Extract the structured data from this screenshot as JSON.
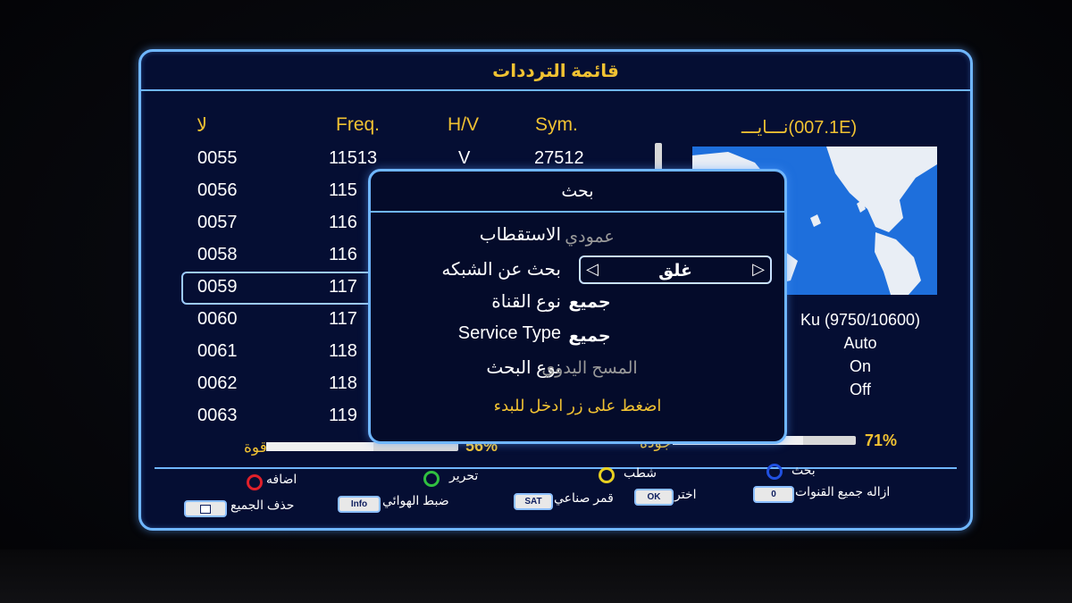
{
  "title": "قائمة الترددات",
  "columns": {
    "num": "لا",
    "freq": "Freq.",
    "pol": "H/V",
    "sym": "Sym."
  },
  "satellite": {
    "name": "نـــايـــ(007.1E)"
  },
  "channels": [
    {
      "num": "0055",
      "freq": "11513",
      "pol": "V",
      "sym": "27512"
    },
    {
      "num": "0056",
      "freq": "115"
    },
    {
      "num": "0057",
      "freq": "116"
    },
    {
      "num": "0058",
      "freq": "116"
    },
    {
      "num": "0059",
      "freq": "117",
      "selected": true
    },
    {
      "num": "0060",
      "freq": "117"
    },
    {
      "num": "0061",
      "freq": "118"
    },
    {
      "num": "0062",
      "freq": "118"
    },
    {
      "num": "0063",
      "freq": "119"
    }
  ],
  "sat_info": {
    "lnb": "Ku (9750/10600)",
    "line2": "Auto",
    "line3": "On",
    "line4": "Off"
  },
  "meters": {
    "strength_label": "قوة",
    "strength_value": "56%",
    "strength": 0.56,
    "quality_label": "جودة",
    "quality_value": "71%",
    "quality": 0.71
  },
  "footer": {
    "red_label": "اضافه",
    "green_label": "تحرير",
    "yellow_label": "شطب",
    "blue_label": "بحث",
    "delete_all": "حذف الجميع",
    "antenna": "ضبط الهوائي",
    "info_key": "Info",
    "satellite": "قمر صناعي",
    "sat_key": "SAT",
    "select": "اختر",
    "ok_key": "OK",
    "remove_all": "ازاله جميع القنوات",
    "zero_key": "0",
    "colors": {
      "red": "#e0202a",
      "green": "#30c040",
      "yellow": "#e8d020",
      "blue": "#2050e0"
    }
  },
  "dialog": {
    "title": "بحث",
    "polarization_label": "الاستقطاب",
    "polarization_value": "عمودي",
    "network_label": "بحث عن الشبكه",
    "network_value": "غلق",
    "channel_type_label": "نوع القناة",
    "channel_type_value": "جميع",
    "service_type_label": "Service Type",
    "service_type_value": "جميع",
    "search_type_label": "نوع البحث",
    "search_type_value": "المسح اليدوي",
    "hint": "اضغط على زر ادخل للبدء"
  }
}
